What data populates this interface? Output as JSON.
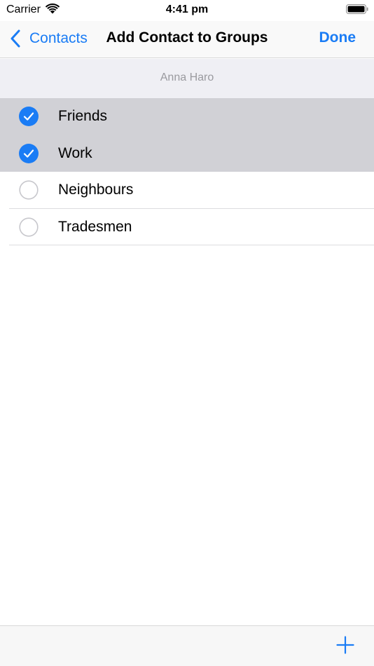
{
  "status_bar": {
    "carrier": "Carrier",
    "time": "4:41 pm",
    "wifi_icon": "wifi-icon",
    "battery_icon": "battery-icon"
  },
  "nav": {
    "back_label": "Contacts",
    "back_icon": "chevron-left-icon",
    "title": "Add Contact to Groups",
    "done_label": "Done"
  },
  "contact": {
    "name": "Anna Haro"
  },
  "groups": [
    {
      "label": "Friends",
      "selected": true
    },
    {
      "label": "Work",
      "selected": true
    },
    {
      "label": "Neighbours",
      "selected": false
    },
    {
      "label": "Tradesmen",
      "selected": false
    }
  ],
  "toolbar": {
    "add_icon": "plus-icon"
  },
  "colors": {
    "accent": "#1a7cf5",
    "selected_row": "#d1d1d6",
    "header_bg": "#efeff4",
    "unchecked_circle": "#c7c7cc"
  }
}
